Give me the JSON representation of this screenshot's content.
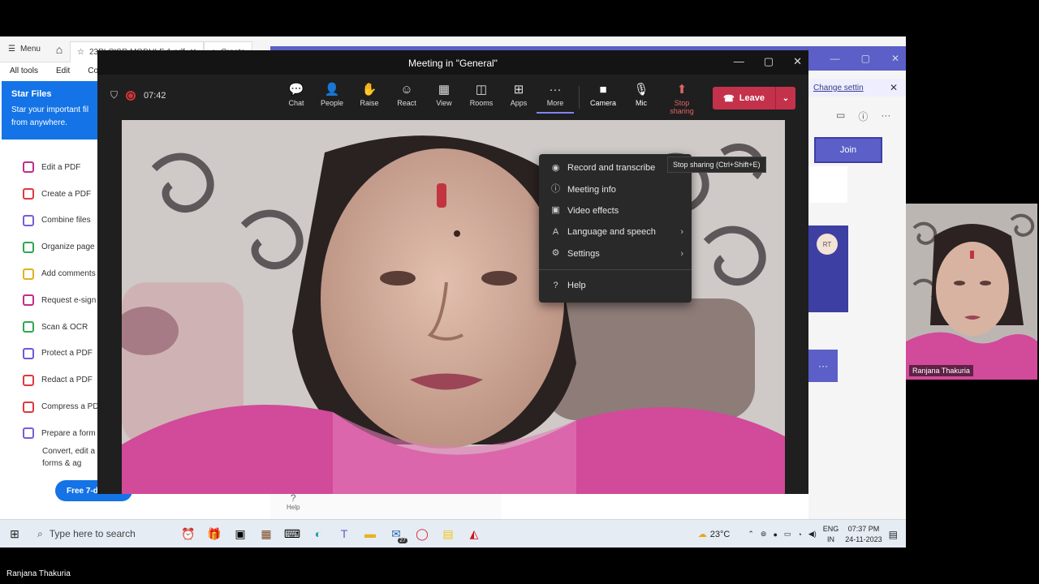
{
  "acrobat": {
    "menu_label": "Menu",
    "tab_label": "23PLCISR MODULE 1.pdf",
    "tab2_label": "Create",
    "menubar": [
      "All tools",
      "Edit",
      "Co"
    ],
    "star_files": {
      "title": "Star Files",
      "desc": "Star your important fil from anywhere."
    },
    "tools": [
      {
        "label": "Edit a PDF",
        "color": "#c42b8a"
      },
      {
        "label": "Create a PDF",
        "color": "#e0393e"
      },
      {
        "label": "Combine files",
        "color": "#7a5cd6"
      },
      {
        "label": "Organize page",
        "color": "#2ea84f"
      },
      {
        "label": "Add comments",
        "color": "#e0b21c"
      },
      {
        "label": "Request e-sign",
        "color": "#c42b8a"
      },
      {
        "label": "Scan & OCR",
        "color": "#2ea84f"
      },
      {
        "label": "Protect a PDF",
        "color": "#6b5bd6"
      },
      {
        "label": "Redact a PDF",
        "color": "#e0393e"
      },
      {
        "label": "Compress a PD",
        "color": "#e0393e"
      },
      {
        "label": "Prepare a form",
        "color": "#7a5cd6"
      }
    ],
    "convert_text": "Convert, edit a forms & ag",
    "free_button": "Free 7-d",
    "help_label": "Help"
  },
  "teams_main": {
    "banner_link": "Change settin",
    "join_label": "Join",
    "avatar_initials": "RT",
    "dots_label": "···"
  },
  "meeting": {
    "title": "Meeting in \"General\"",
    "timer": "07:42",
    "toolbar": [
      {
        "label": "Chat",
        "icon": "chat-icon",
        "glyph": "💬"
      },
      {
        "label": "People",
        "icon": "people-icon",
        "glyph": "👤"
      },
      {
        "label": "Raise",
        "icon": "raise-hand-icon",
        "glyph": "✋"
      },
      {
        "label": "React",
        "icon": "react-icon",
        "glyph": "☺"
      },
      {
        "label": "View",
        "icon": "view-icon",
        "glyph": "▦"
      },
      {
        "label": "Rooms",
        "icon": "rooms-icon",
        "glyph": "◫"
      },
      {
        "label": "Apps",
        "icon": "apps-icon",
        "glyph": "⊞"
      },
      {
        "label": "More",
        "icon": "more-icon",
        "glyph": "···"
      },
      {
        "label": "Camera",
        "icon": "camera-icon",
        "glyph": "■"
      },
      {
        "label": "Mic",
        "icon": "mic-icon",
        "glyph": "🎙"
      },
      {
        "label": "Stop sharing",
        "icon": "stop-sharing-icon",
        "glyph": "⬆"
      }
    ],
    "leave_label": "Leave",
    "more_menu": [
      {
        "label": "Record and transcribe",
        "icon": "record-icon",
        "glyph": "◉"
      },
      {
        "label": "Meeting info",
        "icon": "info-icon",
        "glyph": "ⓘ"
      },
      {
        "label": "Video effects",
        "icon": "video-effects-icon",
        "glyph": "▣"
      },
      {
        "label": "Language and speech",
        "icon": "language-icon",
        "glyph": "A"
      },
      {
        "label": "Settings",
        "icon": "settings-icon",
        "glyph": "⚙"
      }
    ],
    "help_item": {
      "label": "Help",
      "icon": "help-icon",
      "glyph": "?"
    },
    "tooltip": "Stop sharing (Ctrl+Shift+E)"
  },
  "taskbar": {
    "search_placeholder": "Type here to search",
    "weather": "23°C",
    "lang_line1": "ENG",
    "lang_line2": "IN",
    "time": "07:37 PM",
    "date": "24-11-2023",
    "mail_badge": "27"
  },
  "participant": {
    "name": "Ranjana Thakuria"
  },
  "footer_name": "Ranjana Thakuria"
}
